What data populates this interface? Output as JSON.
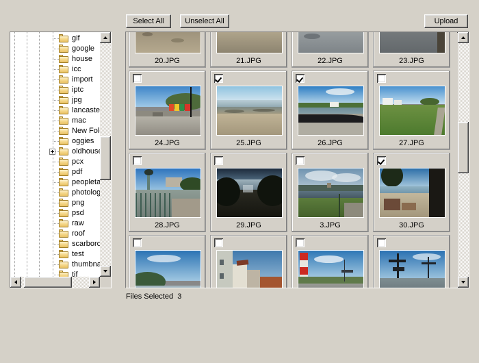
{
  "window": {
    "background_color": "#d5d1c8",
    "face_color": "#d4d0c8"
  },
  "toolbar": {
    "select_all_label": "Select All",
    "unselect_all_label": "Unselect All",
    "upload_label": "Upload"
  },
  "tree": {
    "items": [
      {
        "label": "gif",
        "expandable": false
      },
      {
        "label": "google",
        "expandable": false
      },
      {
        "label": "house",
        "expandable": false
      },
      {
        "label": "icc",
        "expandable": false
      },
      {
        "label": "import",
        "expandable": false
      },
      {
        "label": "iptc",
        "expandable": false
      },
      {
        "label": "jpg",
        "expandable": false
      },
      {
        "label": "lancaster",
        "expandable": false
      },
      {
        "label": "mac",
        "expandable": false
      },
      {
        "label": "New Folder",
        "expandable": false
      },
      {
        "label": "oggies",
        "expandable": false
      },
      {
        "label": "oldhouse",
        "expandable": true
      },
      {
        "label": "pcx",
        "expandable": false
      },
      {
        "label": "pdf",
        "expandable": false
      },
      {
        "label": "peopletaggin",
        "expandable": false
      },
      {
        "label": "photolog",
        "expandable": false
      },
      {
        "label": "png",
        "expandable": false
      },
      {
        "label": "psd",
        "expandable": false
      },
      {
        "label": "raw",
        "expandable": false
      },
      {
        "label": "roof",
        "expandable": false
      },
      {
        "label": "scarborough",
        "expandable": false
      },
      {
        "label": "test",
        "expandable": false
      },
      {
        "label": "thumbnails",
        "expandable": false
      },
      {
        "label": "tif",
        "expandable": false
      }
    ],
    "vscroll": {
      "thumb_top_pct": 42,
      "thumb_height_pct": 20
    },
    "hscroll": {
      "thumb_left_pct": 4,
      "thumb_width_pct": 72
    }
  },
  "grid": {
    "rows": [
      {
        "tiles": [
          {
            "name": "20.JPG",
            "checked": false,
            "scene": "dirt-road"
          },
          {
            "name": "21.JPG",
            "checked": false,
            "scene": "grass-verge"
          },
          {
            "name": "22.JPG",
            "checked": false,
            "scene": "wet-road"
          },
          {
            "name": "23.JPG",
            "checked": false,
            "scene": "dark-road"
          }
        ]
      },
      {
        "tiles": [
          {
            "name": "24.JPG",
            "checked": false,
            "scene": "promenade"
          },
          {
            "name": "25.JPG",
            "checked": true,
            "scene": "low-tide"
          },
          {
            "name": "26.JPG",
            "checked": true,
            "scene": "sea-wall"
          },
          {
            "name": "27.JPG",
            "checked": false,
            "scene": "green-field"
          }
        ]
      },
      {
        "tiles": [
          {
            "name": "28.JPG",
            "checked": false,
            "scene": "lamp-railing"
          },
          {
            "name": "29.JPG",
            "checked": false,
            "scene": "dark-bay"
          },
          {
            "name": "3.JPG",
            "checked": false,
            "scene": "cliff-castle"
          },
          {
            "name": "30.JPG",
            "checked": true,
            "scene": "beach-arch"
          }
        ]
      },
      {
        "tiles": [
          {
            "name": "",
            "checked": false,
            "scene": "hillside-bay"
          },
          {
            "name": "",
            "checked": false,
            "scene": "old-town"
          },
          {
            "name": "",
            "checked": false,
            "scene": "lighthouse-harbour"
          },
          {
            "name": "",
            "checked": false,
            "scene": "harbour-cranes"
          }
        ]
      }
    ],
    "vscroll": {
      "thumb_top_pct": 34,
      "thumb_height_pct": 22
    }
  },
  "status": {
    "text": "Files Selected  3"
  }
}
